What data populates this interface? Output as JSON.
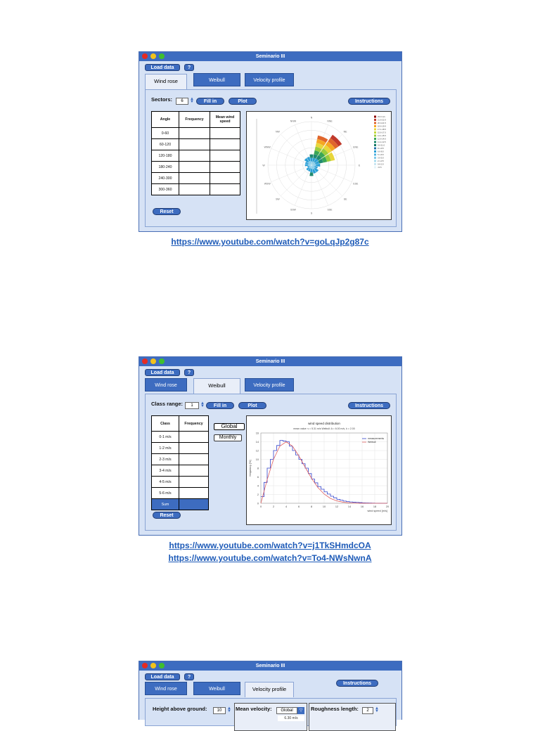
{
  "window_title": "Seminario III",
  "load_data_label": "Load data",
  "help_label": "?",
  "tabs": {
    "wind_rose": "Wind rose",
    "weibull": "Weibull",
    "velocity": "Velocity profile"
  },
  "fill_in_label": "Fill in",
  "plot_label": "Plot",
  "instructions_label": "Instructions",
  "reset_label": "Reset",
  "window1": {
    "sectors_label": "Sectors:",
    "sectors_value": "6",
    "table_headers": [
      "Angle",
      "Frequency",
      "Mean wind speed"
    ],
    "rows": [
      "0-60",
      "60-120",
      "120-180",
      "180-240",
      "240-300",
      "300-360"
    ],
    "link": "https://www.youtube.com/watch?v=goLqJp2g87c"
  },
  "window2": {
    "class_range_label": "Class range:",
    "class_range_value": "1",
    "table_headers": [
      "Class",
      "Frequency"
    ],
    "rows": [
      "0-1 m/s",
      "1-2 m/s",
      "2-3 m/s",
      "3-4 m/s",
      "4-5 m/s",
      "5-6 m/s"
    ],
    "sum_label": "Sum",
    "global_label": "Global",
    "monthly_label": "Monthly",
    "links": [
      "https://www.youtube.com/watch?v=j1TkSHmdcOA",
      "https://www.youtube.com/watch?v=To4-NWsNwnA"
    ]
  },
  "window3": {
    "height_label": "Height above ground:",
    "height_value": "10",
    "mean_velocity_label": "Mean velocity:",
    "mean_velocity_value": "Global",
    "roughness_label": "Roughness length:",
    "roughness_value": "2",
    "dropdown_option": "6.30 m/s"
  },
  "colors": {
    "accent": "#3d6cc0",
    "panel": "#d6e2f5",
    "link": "#1e5bb8"
  },
  "chart_data": [
    {
      "type": "radar",
      "directions": [
        "N",
        "NNE",
        "NE",
        "ENE",
        "E",
        "ESE",
        "SE",
        "SSE",
        "S",
        "SSW",
        "SW",
        "WSW",
        "W",
        "WNW",
        "NW",
        "NNW"
      ],
      "values": [
        5,
        14,
        17,
        11,
        4,
        3,
        4,
        4,
        5,
        3,
        3,
        2,
        3,
        3,
        4,
        4
      ],
      "legend": [
        "23.0 m/s",
        "21.6-22.9",
        "20.0-21.5",
        "18.6-19.9",
        "17.1-18.5",
        "15.6-17.0",
        "14.1-15.5",
        "12.6-14.0",
        "11.1-12.5",
        "9.6-11.0",
        "8.1-9.5",
        "6.6-8.0",
        "5.1-6.5",
        "3.6-5.0",
        "2.1-3.5",
        "0.6-2.0",
        "<0.5"
      ]
    },
    {
      "type": "line",
      "title": "wind speed distribution",
      "subtitle": "mean value: v = 5.31 m/s   Weibull: A = 6.00 m/s, k = 2.00",
      "xlabel": "wind speed [m/s]",
      "ylabel": "frequency [%]",
      "x": [
        0,
        1,
        2,
        3,
        4,
        5,
        6,
        7,
        8,
        9,
        10,
        11,
        12,
        13,
        14,
        15,
        16,
        17,
        18,
        19,
        20
      ],
      "xticks": [
        0,
        2,
        4,
        6,
        8,
        10,
        12,
        14,
        16,
        18,
        20
      ],
      "yticks": [
        0,
        2,
        4,
        6,
        8,
        10,
        12,
        14,
        16
      ],
      "xlim": [
        0,
        20
      ],
      "ylim": [
        0,
        16
      ],
      "series": [
        {
          "name": "measurements",
          "values": [
            1.5,
            8.0,
            12.0,
            14.3,
            14.0,
            12.0,
            10.0,
            8.0,
            5.5,
            3.8,
            2.6,
            1.6,
            0.9,
            0.5,
            0.3,
            0.2,
            0.1,
            0.05,
            0.02,
            0.0,
            0.0
          ]
        },
        {
          "name": "Weibull",
          "values": [
            0,
            5.4,
            10.0,
            13.0,
            14.0,
            13.0,
            10.8,
            8.2,
            5.7,
            3.6,
            2.1,
            1.1,
            0.55,
            0.25,
            0.1,
            0.04,
            0.01,
            0.0,
            0.0,
            0.0,
            0.0
          ]
        }
      ]
    }
  ]
}
